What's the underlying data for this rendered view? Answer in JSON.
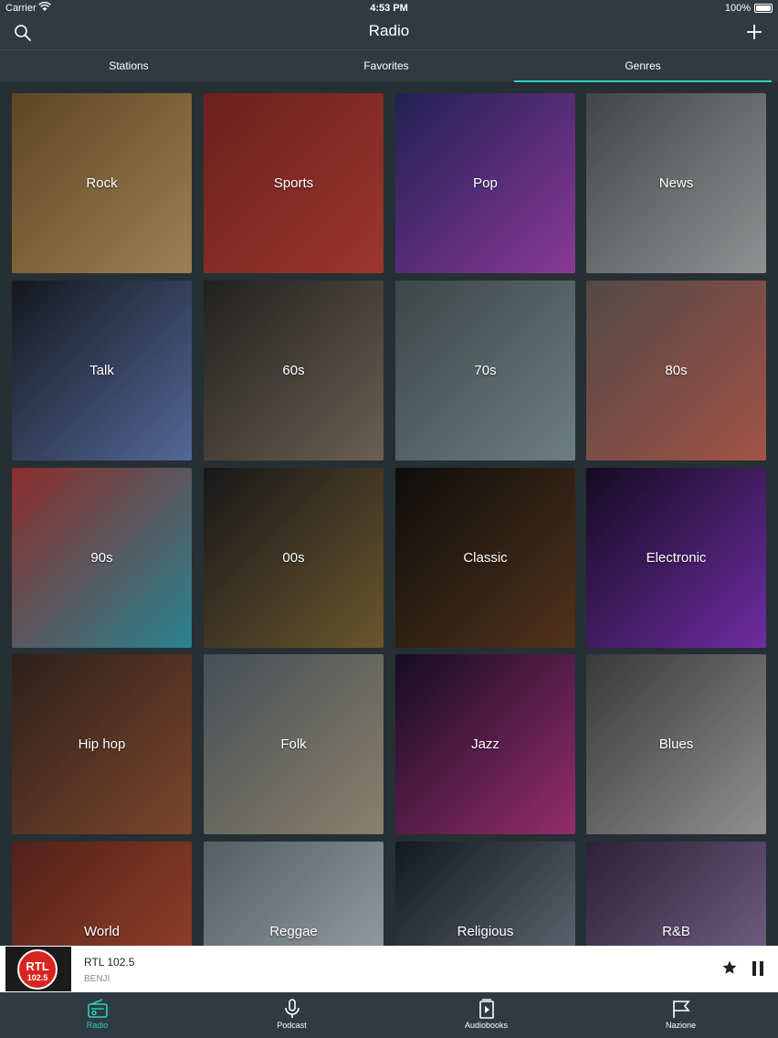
{
  "status": {
    "carrier": "Carrier",
    "time": "4:53 PM",
    "battery": "100%"
  },
  "nav": {
    "title": "Radio"
  },
  "tabs": [
    {
      "label": "Stations",
      "active": false
    },
    {
      "label": "Favorites",
      "active": false
    },
    {
      "label": "Genres",
      "active": true
    }
  ],
  "genres": [
    {
      "label": "Rock",
      "colors": [
        "#7a5a2e",
        "#c8a56b"
      ]
    },
    {
      "label": "Sports",
      "colors": [
        "#8a2a26",
        "#c8463d"
      ]
    },
    {
      "label": "Pop",
      "colors": [
        "#2b2a6e",
        "#b04ac0"
      ]
    },
    {
      "label": "News",
      "colors": [
        "#555a5c",
        "#b9bbbc"
      ]
    },
    {
      "label": "Talk",
      "colors": [
        "#1b1e26",
        "#6a86c2"
      ]
    },
    {
      "label": "60s",
      "colors": [
        "#2a2a2a",
        "#8a7b6a"
      ]
    },
    {
      "label": "70s",
      "colors": [
        "#4e5a5c",
        "#8ca3a6"
      ]
    },
    {
      "label": "80s",
      "colors": [
        "#6a5e5a",
        "#d06a5a"
      ]
    },
    {
      "label": "90s",
      "colors": [
        "#b53a3a",
        "#33a8b8"
      ]
    },
    {
      "label": "00s",
      "colors": [
        "#1e1f22",
        "#8a6f3a"
      ]
    },
    {
      "label": "Classic",
      "colors": [
        "#111111",
        "#6a4222"
      ]
    },
    {
      "label": "Electronic",
      "colors": [
        "#1a0f2a",
        "#8e3ad0"
      ]
    },
    {
      "label": "Hip hop",
      "colors": [
        "#3a2a22",
        "#a05a3a"
      ]
    },
    {
      "label": "Folk",
      "colors": [
        "#5a6670",
        "#b2a48a"
      ]
    },
    {
      "label": "Jazz",
      "colors": [
        "#1a1030",
        "#c03a8a"
      ]
    },
    {
      "label": "Blues",
      "colors": [
        "#4a4a4a",
        "#b8b8b8"
      ]
    },
    {
      "label": "World",
      "colors": [
        "#6a2a20",
        "#c85a3a"
      ]
    },
    {
      "label": "Reggae",
      "colors": [
        "#6a7a80",
        "#cfd6da"
      ]
    },
    {
      "label": "Religious",
      "colors": [
        "#1a2028",
        "#8a96a6"
      ]
    },
    {
      "label": "R&B",
      "colors": [
        "#3a2a4a",
        "#a08ab8"
      ]
    }
  ],
  "player": {
    "station": "RTL 102.5",
    "subtitle": "BENJI",
    "logo_text": "RTL",
    "logo_sub": "102.5"
  },
  "bottom_tabs": [
    {
      "label": "Radio",
      "icon": "radio-icon",
      "active": true
    },
    {
      "label": "Podcast",
      "icon": "microphone-icon",
      "active": false
    },
    {
      "label": "Audiobooks",
      "icon": "audiobook-icon",
      "active": false
    },
    {
      "label": "Nazione",
      "icon": "flag-icon",
      "active": false
    }
  ],
  "accent_color": "#2fd0c4"
}
